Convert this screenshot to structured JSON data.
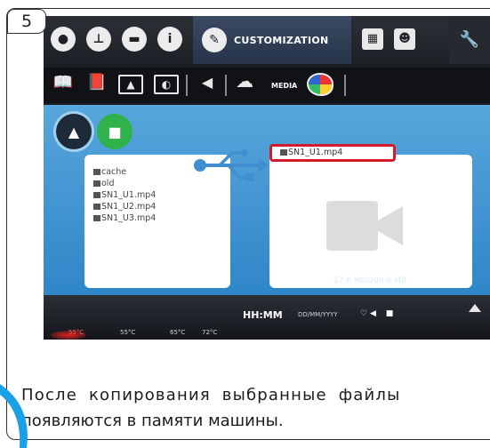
{
  "step": {
    "number": "5"
  },
  "topbar": {
    "active_tab_label": "CUSTOMIZATION",
    "icons": [
      "drop-icon",
      "thermometer-icon",
      "tray-icon",
      "info-icon",
      "pencil-icon",
      "keypad-icon",
      "user-card-icon",
      "wrench-icon"
    ]
  },
  "subbar": {
    "media_label": "MEDIA",
    "icons": [
      "book-icon",
      "book-user-icon",
      "image-icon",
      "screen-icon",
      "speaker-icon",
      "cloud-icon",
      "palette-icon"
    ]
  },
  "media": {
    "left_files": [
      {
        "name": "cache"
      },
      {
        "name": "old"
      },
      {
        "name": "SN1_U1.mp4"
      },
      {
        "name": "SN1_U2.mp4"
      },
      {
        "name": "SN1_U3.mp4"
      }
    ],
    "right_files": [
      {
        "name": "SN1_U1.mp4"
      }
    ],
    "storage": "27.6 Mb/200.0 MB"
  },
  "bottom": {
    "clock": "HH:MM",
    "date": "DD/MM/YYYY",
    "temps": [
      "55°C",
      "55°C",
      "65°C",
      "72°C"
    ]
  },
  "caption": {
    "line1": "После копирования выбранные файлы",
    "line2": "появляются в памяти машины."
  },
  "colors": {
    "highlight": "#d21c2b",
    "media_bg": "#3f96d2",
    "accent_green": "#2fb24c",
    "blue_decor": "#1aa0e6"
  }
}
